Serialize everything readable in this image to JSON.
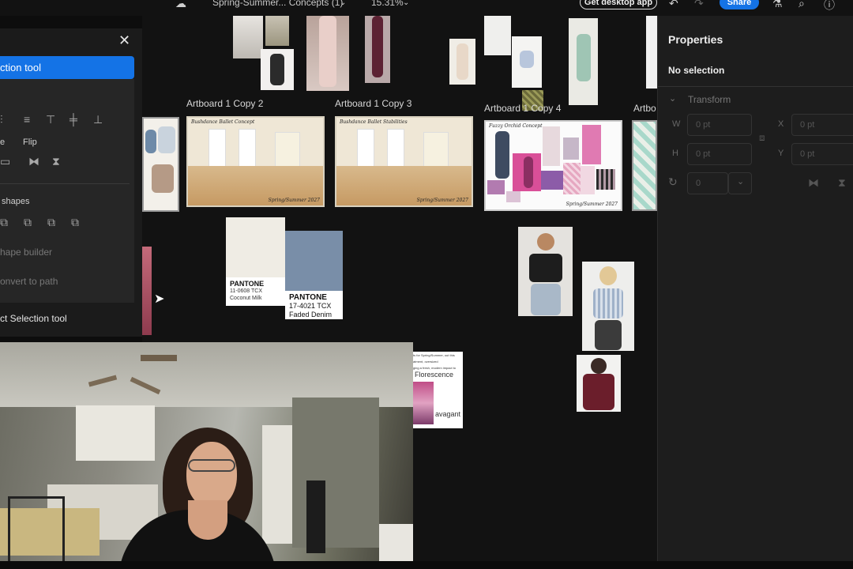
{
  "topbar": {
    "doc_title": "Spring-Summer... Concepts (1)",
    "zoom": "15.31%",
    "get_desktop_app": "Get desktop app",
    "share": "Share"
  },
  "left_panel": {
    "active_tool": "ction tool",
    "flip_label": "Flip",
    "distribute_label": "e",
    "shapes_label": "shapes",
    "shape_builder": "hape builder",
    "convert_to_path": "onvert to path",
    "footer": "ct Selection tool",
    "close_glyph": "✕"
  },
  "artboards": [
    {
      "name": "Artboard 1 Copy 2",
      "header": "Bushdance Ballet Concept",
      "footer": "Spring/Summer 2027"
    },
    {
      "name": "Artboard 1 Copy 3",
      "header": "Bushdance Ballet Stabilities",
      "footer": "Spring/Summer 2027"
    },
    {
      "name": "Artboard 1 Copy 4",
      "header": "Fuzzy Orchid Concept",
      "footer": "Spring/Summer 2027"
    },
    {
      "name": "Artbo"
    }
  ],
  "swatches": [
    {
      "brand": "PANTONE",
      "code": "11-0608 TCX",
      "name": "Coconut Milk",
      "color": "#efece4"
    },
    {
      "brand": "PANTONE",
      "code": "17-4021 TCX",
      "name": "Faded Denim",
      "color": "#798ea8"
    }
  ],
  "florescence_card": {
    "line1": "ts for Spring/Summer, out this",
    "line2": "atment, oversized",
    "line3": "ging a fresh, modern impact to",
    "title": "Florescence",
    "sub": "avagant"
  },
  "properties": {
    "title": "Properties",
    "selection": "No selection",
    "section": "Transform",
    "w_label": "W",
    "h_label": "H",
    "x_label": "X",
    "y_label": "Y",
    "w_value": "0 pt",
    "h_value": "0 pt",
    "x_value": "0 pt",
    "y_value": "0 pt",
    "rotation_value": "0"
  },
  "colors": {
    "accent": "#1473e6",
    "panel": "#1d1d1d",
    "canvas": "#121212"
  }
}
